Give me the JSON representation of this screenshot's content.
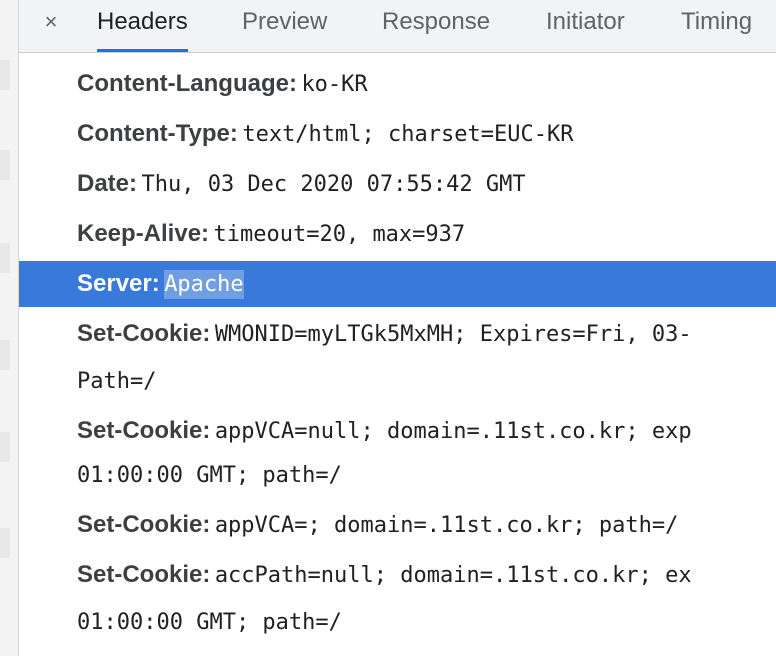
{
  "tabs": {
    "close": "×",
    "items": [
      "Headers",
      "Preview",
      "Response",
      "Initiator",
      "Timing"
    ],
    "active": "Headers"
  },
  "headers": [
    {
      "name": "Content-Language:",
      "value": "ko-KR"
    },
    {
      "name": "Content-Type:",
      "value": "text/html; charset=EUC-KR"
    },
    {
      "name": "Date:",
      "value": "Thu, 03 Dec 2020 07:55:42 GMT"
    },
    {
      "name": "Keep-Alive:",
      "value": "timeout=20, max=937"
    },
    {
      "name": "Server:",
      "value": "Apache"
    },
    {
      "name": "Set-Cookie:",
      "value": "WMONID=myLTGk5MxMH; Expires=Fri, 03-",
      "cont": "Path=/"
    },
    {
      "name": "Set-Cookie:",
      "value": "appVCA=null; domain=.11st.co.kr; exp",
      "cont": "01:00:00 GMT; path=/"
    },
    {
      "name": "Set-Cookie:",
      "value": "appVCA=; domain=.11st.co.kr; path=/"
    },
    {
      "name": "Set-Cookie:",
      "value": "accPath=null; domain=.11st.co.kr; ex",
      "cont": "01:00:00 GMT; path=/"
    }
  ],
  "selected_header": "Server:",
  "colors": {
    "selection": "#3879d9",
    "tab_accent": "#1a73e8"
  }
}
